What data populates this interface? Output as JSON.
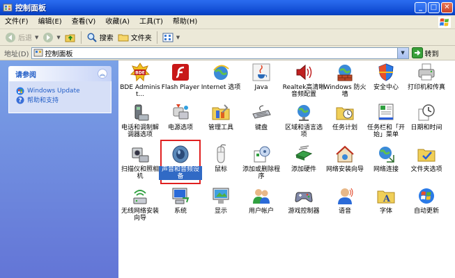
{
  "window": {
    "title": "控制面板"
  },
  "menu": [
    "文件(F)",
    "编辑(E)",
    "查看(V)",
    "收藏(A)",
    "工具(T)",
    "帮助(H)"
  ],
  "toolbar": {
    "back": "后退",
    "search": "搜索",
    "folders": "文件夹"
  },
  "address": {
    "label": "地址(D)",
    "value": "控制面板",
    "go": "转到"
  },
  "panel": {
    "title": "请参阅",
    "links": [
      "Windows Update",
      "帮助和支持"
    ]
  },
  "items": [
    "BDE Administ...",
    "Flash Player",
    "Internet 选项",
    "Java",
    "Realtek高清晰音频配置",
    "Windows 防火墙",
    "安全中心",
    "打印机和传真",
    "电话和调制解调器选项",
    "电源选项",
    "管理工具",
    "键盘",
    "区域和语言选项",
    "任务计划",
    "任务栏和「开始」菜单",
    "日期和时间",
    "扫描仪和照相机",
    "声音和音频设备",
    "鼠标",
    "添加或删除程序",
    "添加硬件",
    "网络安装向导",
    "网络连接",
    "文件夹选项",
    "无线网络安装向导",
    "系统",
    "显示",
    "用户帐户",
    "游戏控制器",
    "语音",
    "字体",
    "自动更新"
  ],
  "selected_item": "声音和音频设备",
  "colors": {
    "titlebar": "#0b47d0",
    "selection": "#316ac5",
    "highlight_frame": "#e02020",
    "panel_link": "#215dc6"
  }
}
